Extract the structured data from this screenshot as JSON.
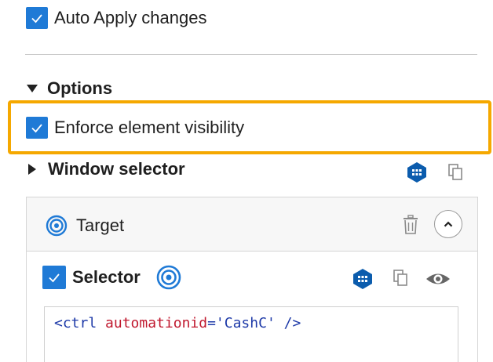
{
  "auto_apply": {
    "label": "Auto Apply changes",
    "checked": true
  },
  "options": {
    "label": "Options",
    "expanded": true
  },
  "enforce_visibility": {
    "label": "Enforce element visibility",
    "checked": true
  },
  "window_selector": {
    "label": "Window selector",
    "expanded": false
  },
  "target": {
    "label": "Target"
  },
  "selector": {
    "label": "Selector",
    "checked": true
  },
  "code": {
    "open": "<ctrl",
    "attr_name": "automationid",
    "equals": "=",
    "attr_value": "'CashC'",
    "close": "/>"
  },
  "colors": {
    "accent": "#1f7ad6",
    "highlight": "#f5a800",
    "icon_blue": "#0b5cad"
  },
  "icons": {
    "checkbox": "check-icon",
    "tree_icon": "hexagon-tree-icon",
    "copy": "copy-icon",
    "target": "target-icon",
    "delete": "trash-icon",
    "collapse": "chevron-up-icon",
    "preview": "eye-icon"
  }
}
